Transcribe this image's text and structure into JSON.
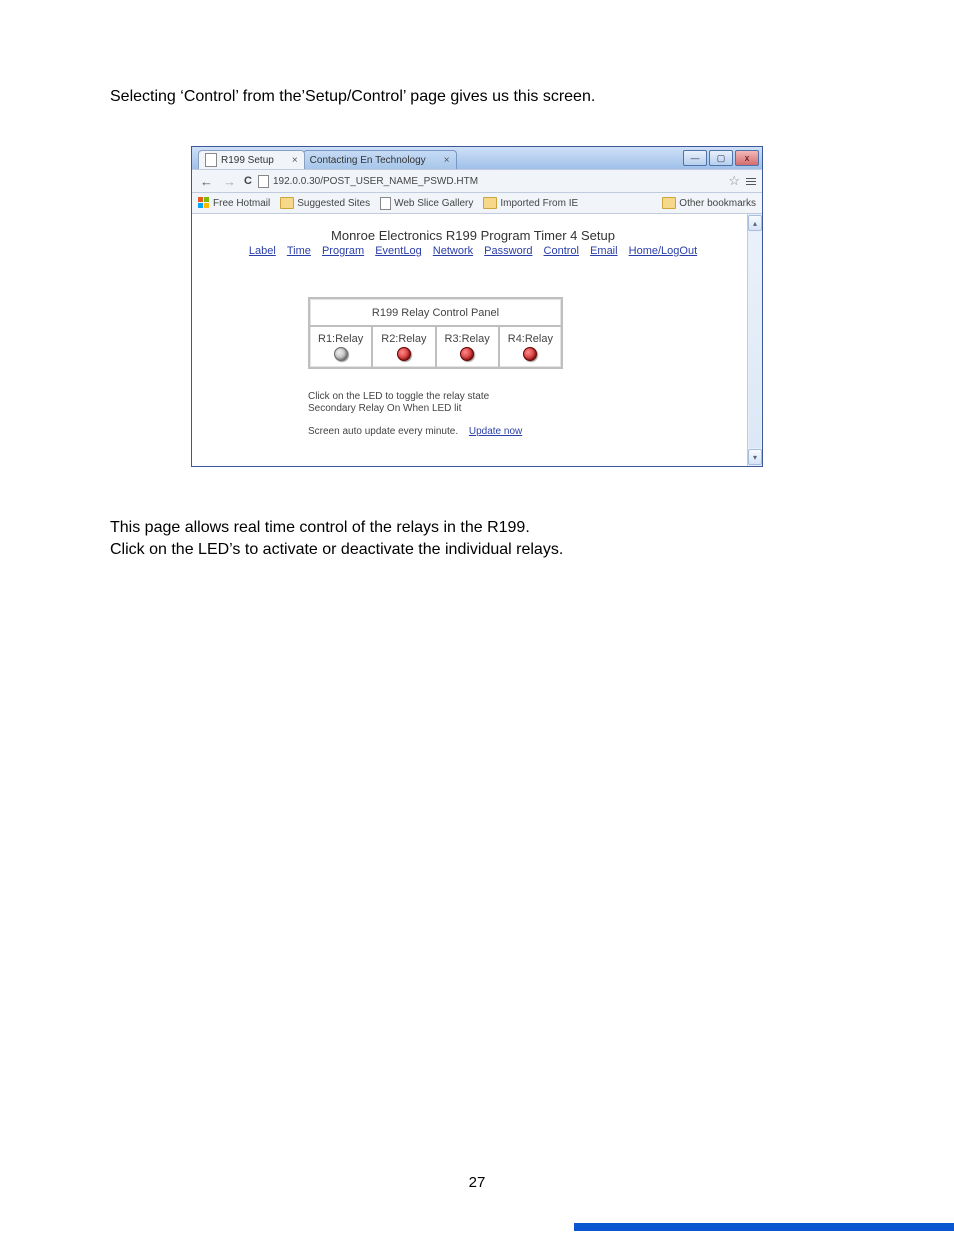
{
  "doc": {
    "intro": "Selecting ‘Control’ from the’Setup/Control’ page gives us this screen.",
    "outro1": "This page allows real time control of the relays in the R199.",
    "outro2": "Click on the LED’s to activate or deactivate the individual relays.",
    "pagenum": "27"
  },
  "window": {
    "tabs": [
      {
        "label": "R199 Setup",
        "active": true
      },
      {
        "label": "Contacting En Technology",
        "active": false
      }
    ],
    "url": "192.0.0.30/POST_USER_NAME_PSWD.HTM",
    "bookmarks": {
      "items": [
        {
          "icon": "flag",
          "label": "Free Hotmail"
        },
        {
          "icon": "folder",
          "label": "Suggested Sites"
        },
        {
          "icon": "page",
          "label": "Web Slice Gallery"
        },
        {
          "icon": "folder",
          "label": "Imported From IE"
        }
      ],
      "right": {
        "icon": "folder",
        "label": "Other bookmarks"
      }
    }
  },
  "content": {
    "title": "Monroe Electronics R199 Program Timer 4 Setup",
    "nav": [
      "Label",
      "Time",
      "Program",
      "EventLog",
      "Network",
      "Password",
      "Control",
      "Email",
      "Home/LogOut"
    ],
    "panel": {
      "title": "R199 Relay Control Panel",
      "relays": [
        {
          "label": "R1:Relay",
          "on": false
        },
        {
          "label": "R2:Relay",
          "on": true
        },
        {
          "label": "R3:Relay",
          "on": true
        },
        {
          "label": "R4:Relay",
          "on": true
        }
      ],
      "note1": "Click on the LED to toggle the relay state",
      "note2": "Secondary Relay On When LED lit",
      "note3": "Screen auto update every minute.",
      "update_link": "Update now"
    }
  }
}
